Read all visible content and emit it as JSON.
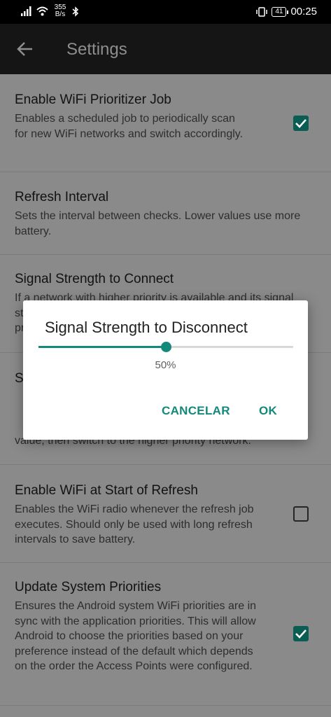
{
  "status_bar": {
    "net_speed_value": "355",
    "net_speed_unit": "B/s",
    "battery": "41",
    "time": "00:25",
    "icons": [
      "signal-icon",
      "wifi-icon",
      "bluetooth-icon",
      "vibrate-icon",
      "battery-icon"
    ]
  },
  "appbar": {
    "title": "Settings"
  },
  "prefs": [
    {
      "title": "Enable WiFi Prioritizer Job",
      "summary": "Enables a scheduled job to periodically scan for new WiFi networks and switch accordingly.",
      "checked": true
    },
    {
      "title": "Refresh Interval",
      "summary": "Sets the interval between checks. Lower values use more battery."
    },
    {
      "title": "Signal Strength to Connect",
      "summary": "If a network with higher priority is available and its signal strength is greater than this value, then switch to the higher priority network."
    },
    {
      "title": "S",
      "summary": "value, then switch to the higher priority network."
    },
    {
      "title": "Enable WiFi at Start of Refresh",
      "summary": "Enables the WiFi radio whenever the refresh job executes. Should only be used with long refresh intervals to save battery.",
      "checked": false
    },
    {
      "title": "Update System Priorities",
      "summary": "Ensures the Android system WiFi priorities are in sync with the application priorities. This will allow Android to choose the priorities based on your preference instead of the default which depends on the order the Access Points were configured.",
      "checked": true
    }
  ],
  "dialog": {
    "title": "Signal Strength to Disconnect",
    "slider_value": 0.5,
    "percent_label": "50%",
    "cancel_label": "CANCELAR",
    "ok_label": "OK"
  },
  "colors": {
    "accent": "#13897a",
    "checkbox": "#0a5d52",
    "scrim": "#8a8a8a"
  }
}
